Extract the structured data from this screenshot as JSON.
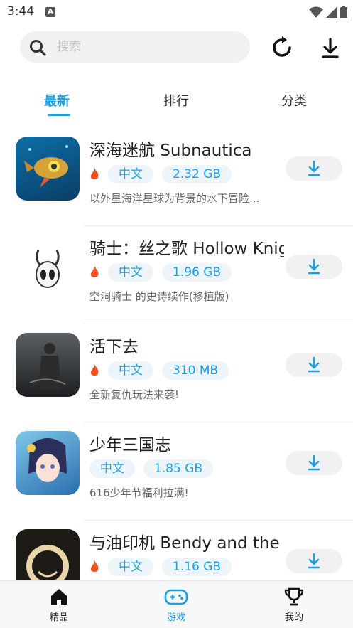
{
  "status_bar": {
    "time": "3:44",
    "notif_icon_letter": "A"
  },
  "search": {
    "placeholder": "搜索"
  },
  "tabs": [
    {
      "label": "最新",
      "active": true
    },
    {
      "label": "排行",
      "active": false
    },
    {
      "label": "分类",
      "active": false
    }
  ],
  "games": [
    {
      "title": "深海迷航 Subnautica",
      "lang": "中文",
      "size": "2.32 GB",
      "desc": "以外星海洋星球为背景的水下冒险...",
      "hot": true
    },
    {
      "title": "骑士：丝之歌 Hollow Knight",
      "lang": "中文",
      "size": "1.96 GB",
      "desc": "空洞骑士 的史诗续作(移植版)",
      "hot": true
    },
    {
      "title": "活下去",
      "lang": "中文",
      "size": "310 MB",
      "desc": "全新复仇玩法来袭!",
      "hot": true
    },
    {
      "title": "少年三国志",
      "lang": "中文",
      "size": "1.85 GB",
      "desc": "616少年节福利拉满!",
      "hot": false
    },
    {
      "title": "与油印机 Bendy and the Ink Machine",
      "lang": "中文",
      "size": "1.16 GB",
      "desc": "",
      "hot": true
    }
  ],
  "bottom_nav": [
    {
      "label": "精品",
      "icon": "home-icon",
      "active": false
    },
    {
      "label": "游戏",
      "icon": "gamepad-icon",
      "active": true
    },
    {
      "label": "我的",
      "icon": "trophy-icon",
      "active": false
    }
  ],
  "colors": {
    "accent": "#1ba0e2",
    "fire": "#f4511e",
    "tag_bg": "#edf5fa"
  }
}
